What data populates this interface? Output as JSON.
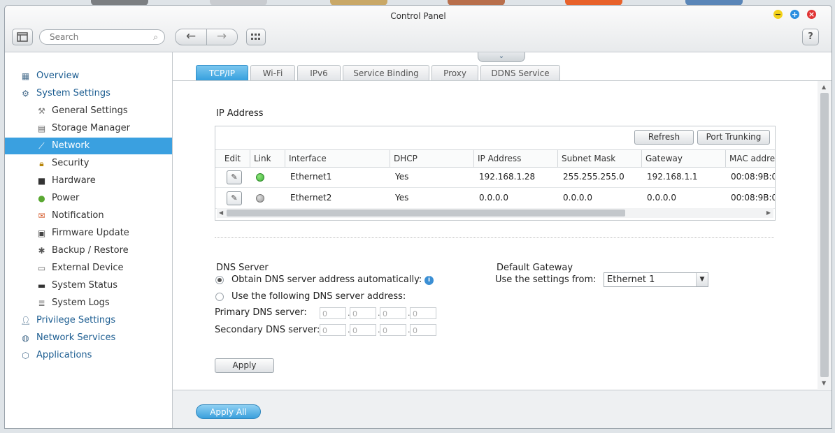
{
  "window": {
    "title": "Control Panel",
    "help_label": "?"
  },
  "toolbar": {
    "search_placeholder": "Search"
  },
  "sidebar": {
    "overview": "Overview",
    "system_settings": "System Settings",
    "sub_items": [
      "General Settings",
      "Storage Manager",
      "Network",
      "Security",
      "Hardware",
      "Power",
      "Notification",
      "Firmware Update",
      "Backup / Restore",
      "External Device",
      "System Status",
      "System Logs"
    ],
    "privilege_settings": "Privilege Settings",
    "network_services": "Network Services",
    "applications": "Applications",
    "active": "Network"
  },
  "tabs": [
    "TCP/IP",
    "Wi-Fi",
    "IPv6",
    "Service Binding",
    "Proxy",
    "DDNS Service"
  ],
  "ip_section": {
    "title": "IP Address",
    "refresh_label": "Refresh",
    "trunking_label": "Port Trunking",
    "columns": [
      "Edit",
      "Link",
      "Interface",
      "DHCP",
      "IP Address",
      "Subnet Mask",
      "Gateway",
      "MAC addre"
    ],
    "rows": [
      {
        "interface": "Ethernet1",
        "dhcp": "Yes",
        "ip": "192.168.1.28",
        "mask": "255.255.255.0",
        "gateway": "192.168.1.1",
        "mac": "00:08:9B:0",
        "link": "up"
      },
      {
        "interface": "Ethernet2",
        "dhcp": "Yes",
        "ip": "0.0.0.0",
        "mask": "0.0.0.0",
        "gateway": "0.0.0.0",
        "mac": "00:08:9B:0",
        "link": "down"
      }
    ]
  },
  "dns": {
    "title": "DNS Server",
    "auto_label": "Obtain DNS server address automatically:",
    "manual_label": "Use the following DNS server address:",
    "primary_label": "Primary DNS server:",
    "secondary_label": "Secondary DNS server:",
    "octet": "0",
    "apply_label": "Apply"
  },
  "gateway": {
    "title": "Default Gateway",
    "label": "Use the settings from:",
    "value": "Ethernet 1"
  },
  "footer": {
    "apply_all_label": "Apply All"
  },
  "colors": {
    "accent": "#3aa0e0",
    "link_up": "#3fb23a",
    "link_down": "#9a9a9a"
  }
}
